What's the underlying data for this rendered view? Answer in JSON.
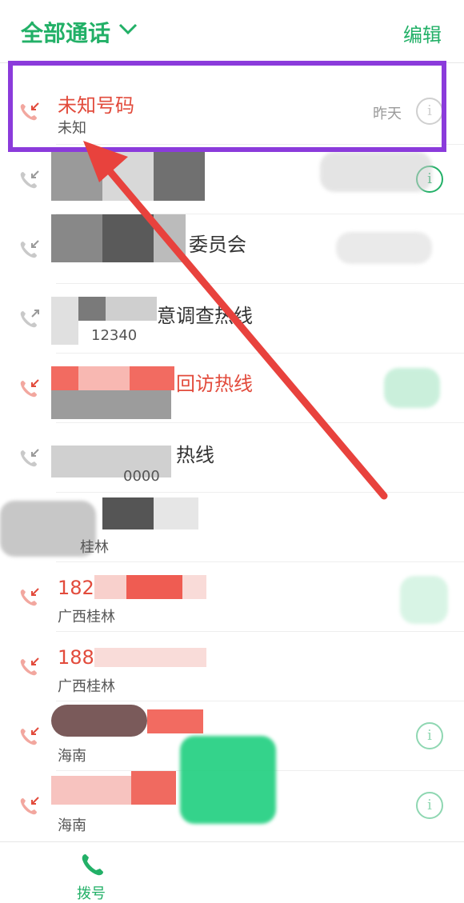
{
  "header": {
    "title": "全部通话",
    "edit_label": "编辑"
  },
  "calls": [
    {
      "name": "未知号码",
      "location": "未知",
      "time": "昨天",
      "missed": true
    },
    {
      "name": "",
      "location": "",
      "time": "",
      "missed": false
    },
    {
      "name": "委员会",
      "location": "",
      "time": "",
      "missed": false
    },
    {
      "name": "意调查热线",
      "location": "12340",
      "time": "",
      "missed": false
    },
    {
      "name": "回访热线",
      "location": "",
      "time": "",
      "missed": true
    },
    {
      "name": "热线",
      "location": "0000",
      "time": "",
      "missed": false
    },
    {
      "name": "",
      "location": "桂林",
      "time": "",
      "missed": false
    },
    {
      "name": "182",
      "location": "广西桂林",
      "time": "",
      "missed": true
    },
    {
      "name": "188",
      "location": "广西桂林",
      "time": "",
      "missed": true
    },
    {
      "name": "",
      "location": "海南",
      "time": "",
      "missed": true
    },
    {
      "name": "",
      "location": "海南",
      "time": "",
      "missed": true
    }
  ],
  "bottom_nav": {
    "dial_label": "拨号"
  },
  "colors": {
    "accent": "#22b067",
    "missed": "#e24b3c",
    "highlight": "#8b3bdb",
    "arrow": "#e8423d"
  }
}
